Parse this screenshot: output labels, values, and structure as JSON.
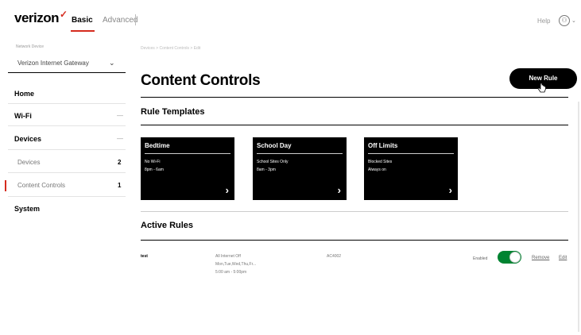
{
  "header": {
    "logo": "verizon",
    "logo_mark": "✓",
    "tabs": [
      {
        "label": "Basic",
        "active": true
      },
      {
        "label": "Advanced",
        "active": false
      }
    ],
    "help_label": "Help",
    "user_icon": "user-circle-icon",
    "user_glyph": "⚇",
    "caret_glyph": "⌄"
  },
  "sidebar": {
    "device_label": "Network Device",
    "device_select_value": "Verizon Internet Gateway",
    "device_select_caret": "⌄",
    "items": [
      {
        "label": "Home"
      },
      {
        "label": "Wi-Fi",
        "marker": "—"
      },
      {
        "label": "Devices",
        "marker": "—"
      },
      {
        "label": "System"
      }
    ],
    "sub_items": [
      {
        "label": "Devices",
        "count": "2"
      },
      {
        "label": "Content Controls",
        "count": "1",
        "active": true
      }
    ]
  },
  "main": {
    "breadcrumb": "Devices  >  Content Controls  >  Edit",
    "title": "Content Controls",
    "new_rule_label": "New Rule",
    "rule_templates_title": "Rule Templates",
    "templates": [
      {
        "title": "Bedtime",
        "line1": "No Wi-Fi",
        "line2": "8pm - 6am",
        "chevron": "›"
      },
      {
        "title": "School Day",
        "line1": "School Sites Only",
        "line2": "8am - 3pm",
        "chevron": "›"
      },
      {
        "title": "Off Limits",
        "line1": "Blocked Sites",
        "line2": "Always on",
        "chevron": "›"
      }
    ],
    "active_rules_title": "Active Rules",
    "active_rules": [
      {
        "name": "test",
        "line1": "All Internet Off",
        "line2": "Mon,Tue,Wed,Thu,Fr...",
        "line3": "5:00 am - 5:00pm",
        "code": "AC4002",
        "status_label": "Enabled",
        "enabled": true,
        "remove_label": "Remove",
        "edit_label": "Edit"
      }
    ]
  },
  "colors": {
    "brand_red": "#d52b1e",
    "toggle_green": "#008331",
    "card_bg": "#000000"
  }
}
